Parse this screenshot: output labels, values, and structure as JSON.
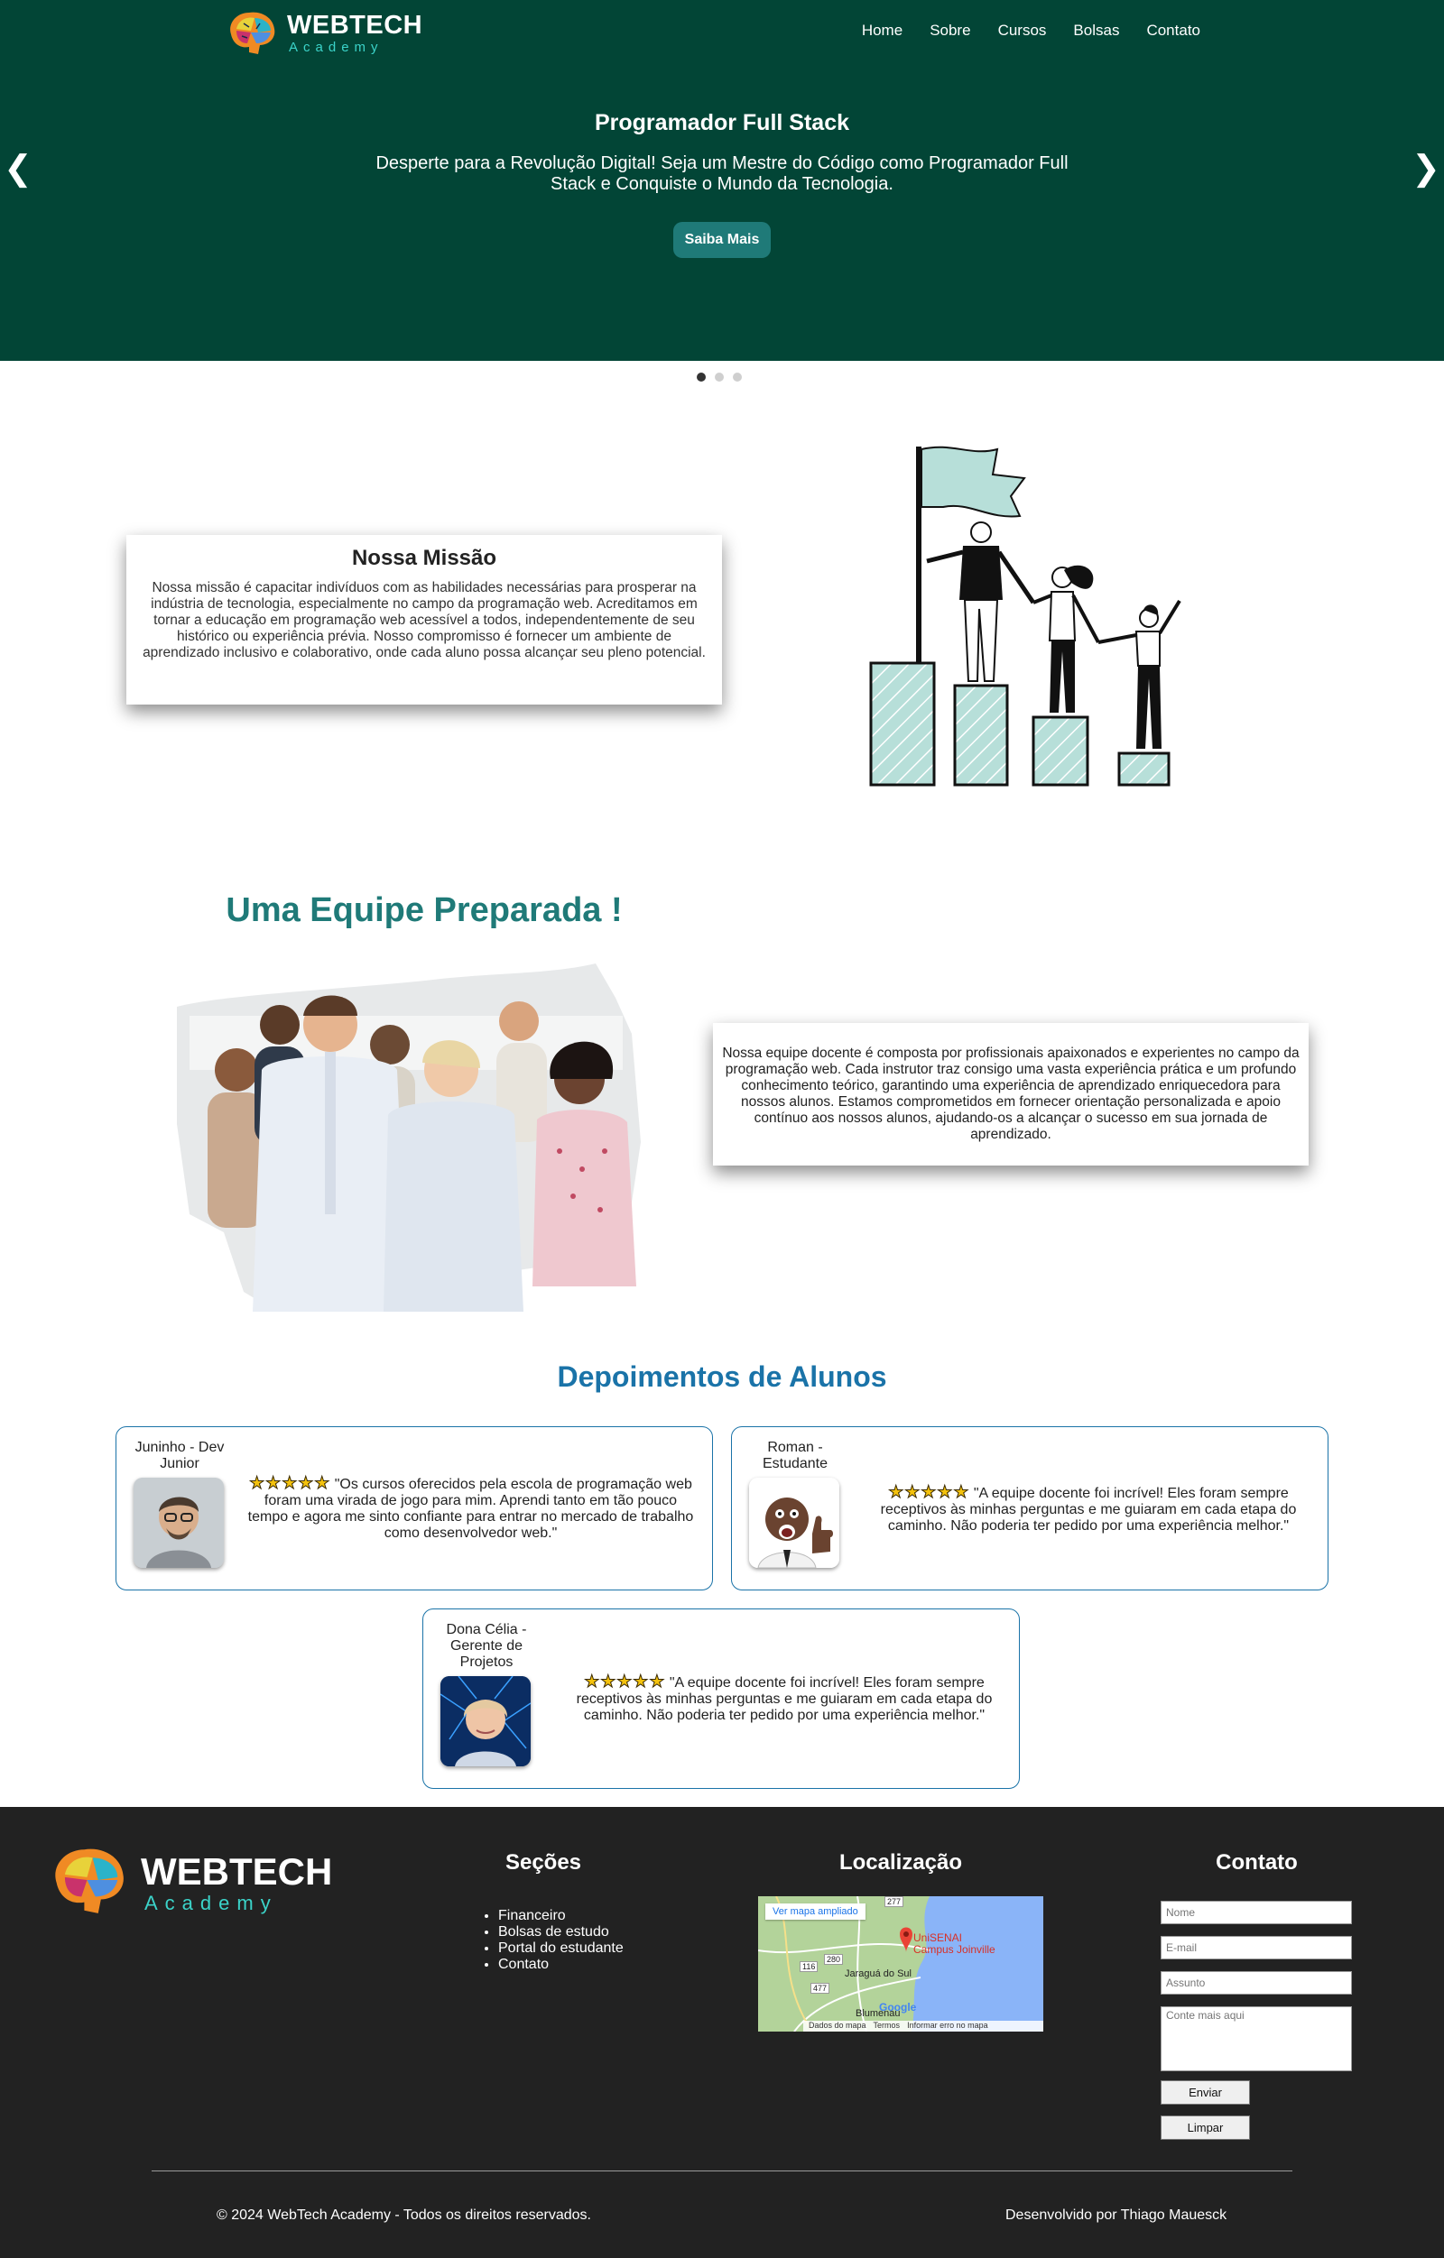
{
  "header": {
    "brand_name": "WEBTECH",
    "brand_sub": "Academy",
    "nav": [
      "Home",
      "Sobre",
      "Cursos",
      "Bolsas",
      "Contato"
    ]
  },
  "hero": {
    "title": "Programador Full Stack",
    "text": "Desperte para a Revolução Digital! Seja um Mestre do Código como Programador Full Stack e Conquiste o Mundo da Tecnologia.",
    "button": "Saiba Mais",
    "prev_arrow": "❮",
    "next_arrow": "❯",
    "slide_count": 3,
    "active_slide": 1
  },
  "mission": {
    "title": "Nossa Missão",
    "text": "Nossa missão é capacitar indivíduos com as habilidades necessárias para prosperar na indústria de tecnologia, especialmente no campo da programação web. Acreditamos em tornar a educação em programação web acessível a todos, independentemente de seu histórico ou experiência prévia. Nosso compromisso é fornecer um ambiente de aprendizado inclusivo e colaborativo, onde cada aluno possa alcançar seu pleno potencial."
  },
  "team": {
    "title": "Uma Equipe Preparada !",
    "text": "Nossa equipe docente é composta por profissionais apaixonados e experientes no campo da programação web. Cada instrutor traz consigo uma vasta experiência prática e um profundo conhecimento teórico, garantindo uma experiência de aprendizado enriquecedora para nossos alunos. Estamos comprometidos em fornecer orientação personalizada e apoio contínuo aos nossos alunos, ajudando-os a alcançar o sucesso em sua jornada de aprendizado."
  },
  "testimonials": {
    "title": "Depoimentos de Alunos",
    "items": [
      {
        "name": "Juninho - Dev Junior",
        "stars": "★★★★★",
        "rating": 5,
        "quote": "\"Os cursos oferecidos pela escola de programação web foram uma virada de jogo para mim. Aprendi tanto em tão pouco tempo e agora me sinto confiante para entrar no mercado de trabalho como desenvolvedor web.\""
      },
      {
        "name": "Roman - Estudante",
        "stars": "★★★★★",
        "rating": 5,
        "quote": "\"A equipe docente foi incrível! Eles foram sempre receptivos às minhas perguntas e me guiaram em cada etapa do caminho. Não poderia ter pedido por uma experiência melhor.\""
      },
      {
        "name": "Dona Célia - Gerente de Projetos",
        "stars": "★★★★★",
        "rating": 5,
        "quote": "\"A equipe docente foi incrível! Eles foram sempre receptivos às minhas perguntas e me guiaram em cada etapa do caminho. Não poderia ter pedido por uma experiência melhor.\""
      }
    ]
  },
  "footer": {
    "sections_title": "Seções",
    "sections": [
      "Financeiro",
      "Bolsas de estudo",
      "Portal do estudante",
      "Contato"
    ],
    "location_title": "Localização",
    "map": {
      "link": "Ver mapa ampliado",
      "pin_label_1": "UniSENAI",
      "pin_label_2": "Campus Joinville",
      "city_1": "Jaraguá do Sul",
      "city_2": "Blumenau",
      "road_1": "280",
      "road_2": "116",
      "road_3": "477",
      "road_4": "277",
      "google": "Google",
      "bar": [
        "Dados do mapa",
        "Termos",
        "Informar erro no mapa"
      ]
    },
    "contact_title": "Contato",
    "form": {
      "name_placeholder": "Nome",
      "email_placeholder": "E-mail",
      "subject_placeholder": "Assunto",
      "message_placeholder": "Conte mais aqui",
      "send": "Enviar",
      "clear": "Limpar"
    },
    "copyright": "© 2024 WebTech Academy - Todos os direitos reservados.",
    "credit": "Desenvolvido por Thiago Mauesck"
  },
  "colors": {
    "hero_bg": "#024536",
    "accent_teal": "#1f7a78",
    "testimonial_blue": "#1a73a8",
    "footer_bg": "#222222"
  },
  "icons": {
    "logo": "colorful-brain-logo",
    "prev": "chevron-left-icon",
    "next": "chevron-right-icon",
    "star": "star-icon",
    "map_pin": "map-pin-icon"
  }
}
